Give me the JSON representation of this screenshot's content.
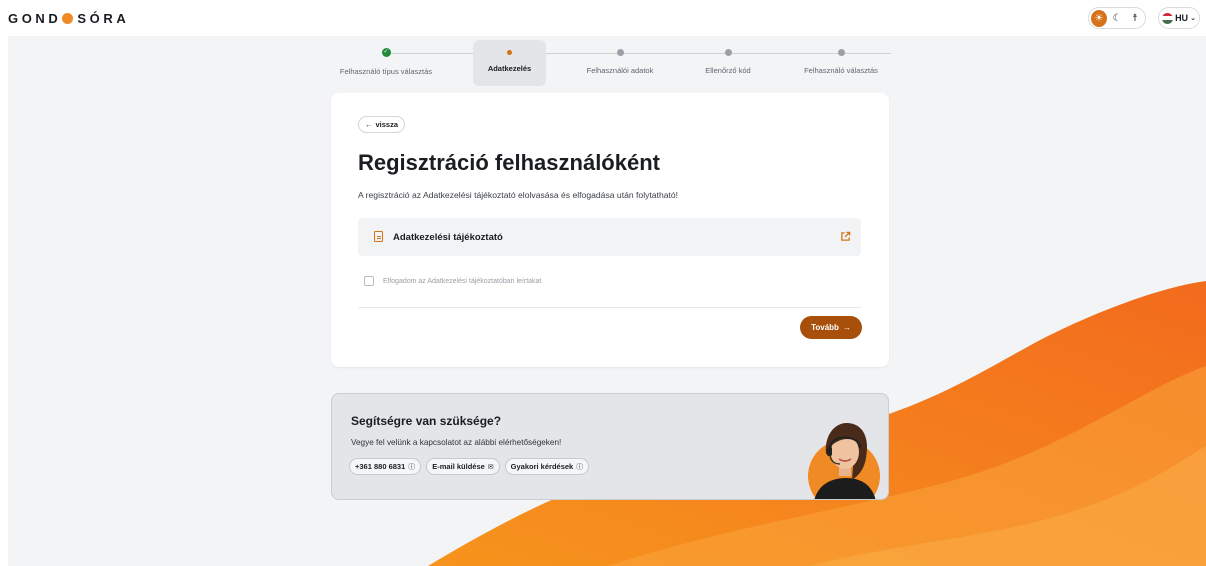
{
  "brand": {
    "logo_left": "GOND",
    "logo_right": "SÓRA",
    "accent": "#f08a24",
    "button_color": "#a84f0b"
  },
  "header": {
    "theme_toggles": [
      "sun-icon",
      "moon-icon",
      "accessibility-icon"
    ],
    "language": "HU"
  },
  "stepper": {
    "steps": [
      {
        "label": "Felhasználó típus választás",
        "state": "done"
      },
      {
        "label": "Adatkezelés",
        "state": "active"
      },
      {
        "label": "Felhasználói adatok",
        "state": "pending"
      },
      {
        "label": "Ellenőrző kód",
        "state": "pending"
      },
      {
        "label": "Felhasználó választás",
        "state": "pending"
      }
    ]
  },
  "card": {
    "back_label": "vissza",
    "title": "Regisztráció felhasználóként",
    "intro": "A regisztráció az Adatkezelési tájékoztató elolvasása és elfogadása után folytatható!",
    "document_label": "Adatkezelési tájékoztató",
    "checkbox_label": "Elfogadom az Adatkezelési tájékoztatóban leírtakat",
    "checkbox_checked": false,
    "next_label": "Tovább"
  },
  "help": {
    "title": "Segítségre van szüksége?",
    "text": "Vegye fel velünk a kapcsolatot az alábbi elérhetőségeken!",
    "chips": [
      {
        "label": "+361 880 6831",
        "icon": "help-circle-icon"
      },
      {
        "label": "E-mail küldése",
        "icon": "mail-icon"
      },
      {
        "label": "Gyakori kérdések",
        "icon": "help-circle-icon"
      }
    ]
  }
}
